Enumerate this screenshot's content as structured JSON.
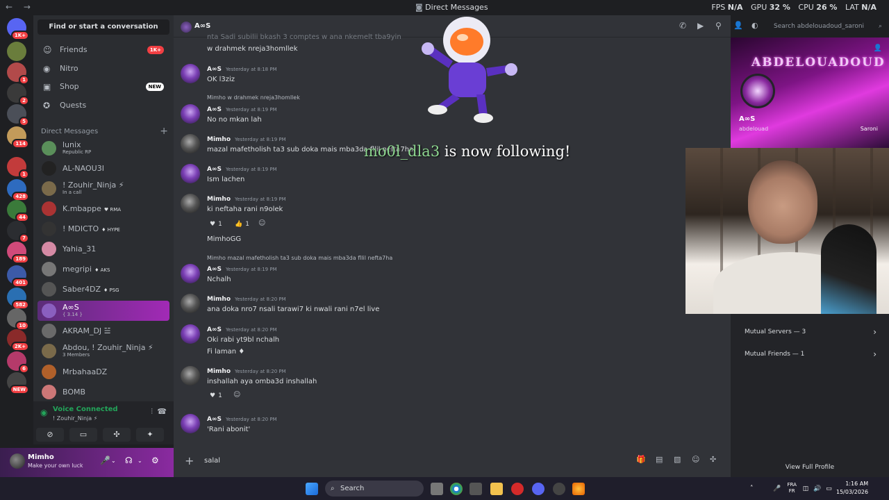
{
  "window": {
    "title": "Direct Messages",
    "nav_icons": "← →",
    "perf": [
      {
        "label": "FPS",
        "value": "N/A"
      },
      {
        "label": "GPU",
        "value": "32 %"
      },
      {
        "label": "CPU",
        "value": "26 %"
      },
      {
        "label": "LAT",
        "value": "N/A"
      }
    ]
  },
  "servers": [
    {
      "badge": "1K+",
      "color": "#5865f2"
    },
    {
      "badge": "",
      "color": "#6a7d3c"
    },
    {
      "badge": "1",
      "color": "#b24a4a"
    },
    {
      "badge": "2",
      "color": "#3a3a3a"
    },
    {
      "badge": "5",
      "color": "#4b4f58"
    },
    {
      "badge": "114",
      "color": "#c29b5a"
    },
    {
      "badge": "1",
      "color": "#c23b3b"
    },
    {
      "badge": "428",
      "color": "#2e6bbf"
    },
    {
      "badge": "44",
      "color": "#3a7a3a"
    },
    {
      "badge": "7",
      "color": "#2b2d31"
    },
    {
      "badge": "189",
      "color": "#d04a7a"
    },
    {
      "badge": "401",
      "color": "#3c5aa8"
    },
    {
      "badge": "582",
      "color": "#2a6fb2"
    },
    {
      "badge": "10",
      "color": "#666"
    },
    {
      "badge": "2K+",
      "color": "#8a2a2a"
    },
    {
      "badge": "6",
      "color": "#b53a6a"
    },
    {
      "badge": "NEW",
      "color": "#444"
    }
  ],
  "sidebar": {
    "find_label": "Find or start a conversation",
    "nav": [
      {
        "label": "Friends",
        "icon": "friends-icon",
        "glyph": "☺",
        "pill": "1K+"
      },
      {
        "label": "Nitro",
        "icon": "nitro-icon",
        "glyph": "◉",
        "pill": ""
      },
      {
        "label": "Shop",
        "icon": "shop-icon",
        "glyph": "▣",
        "pill": "NEW"
      },
      {
        "label": "Quests",
        "icon": "quests-icon",
        "glyph": "✪",
        "pill": ""
      }
    ],
    "dm_header": "Direct Messages",
    "dms": [
      {
        "name": "lunix",
        "sub": "Republic RP",
        "tag": "",
        "color": "#5a8f5a"
      },
      {
        "name": "AL-NAOU3I",
        "sub": "",
        "tag": "",
        "color": "#222"
      },
      {
        "name": "! Zouhir_Ninja ⚡",
        "sub": "In a call",
        "tag": "",
        "color": "#7a6a4a"
      },
      {
        "name": "K.mbappe",
        "sub": "",
        "tag": "♥ RMA",
        "color": "#a33"
      },
      {
        "name": "! MDICTO",
        "sub": "",
        "tag": "♦ HYPE",
        "color": "#333"
      },
      {
        "name": "Yahia_31",
        "sub": "",
        "tag": "",
        "color": "#d58aa5"
      },
      {
        "name": "megripi",
        "sub": "",
        "tag": "♦ AKS",
        "color": "#777"
      },
      {
        "name": "Saber4DZ",
        "sub": "",
        "tag": "♦ PSG",
        "color": "#555"
      },
      {
        "name": "A∞S",
        "sub": "{ 3.14 }",
        "tag": "",
        "color": "#8a5fbf"
      },
      {
        "name": "AKRAM_DJ ☱",
        "sub": "",
        "tag": "",
        "color": "#6a6a6a"
      },
      {
        "name": "Abdou, ! Zouhir_Ninja ⚡",
        "sub": "3 Members",
        "tag": "",
        "color": "#7a6a4a"
      },
      {
        "name": "MrbahaaDZ",
        "sub": "",
        "tag": "",
        "color": "#b0602a"
      },
      {
        "name": "BOMB",
        "sub": "",
        "tag": "",
        "color": "#c77"
      }
    ]
  },
  "voice": {
    "status": "Voice Connected",
    "channel": "! Zouhir_Ninja ⚡"
  },
  "user": {
    "name": "Mimho",
    "status": "Make your own luck"
  },
  "chat": {
    "header_name": "A∞S",
    "search_placeholder": "Search abdelouadoud_saroni",
    "messages": [
      {
        "type": "cont",
        "text": "w drahmek nreja3homllek"
      },
      {
        "type": "msg",
        "author": "A∞S",
        "time": "Yesterday at 8:18 PM",
        "lines": [
          "OK l3ziz"
        ],
        "av": "aos"
      },
      {
        "type": "msg",
        "reply": "Mimho w drahmek nreja3homllek",
        "author": "A∞S",
        "time": "Yesterday at 8:19 PM",
        "lines": [
          "No no mkan lah"
        ],
        "av": "aos"
      },
      {
        "type": "msg",
        "author": "Mimho",
        "time": "Yesterday at 8:19 PM",
        "lines": [
          "mazal mafetholish ta3 sub doka mais mba3da fllil nefta7ha"
        ],
        "av": "mimho"
      },
      {
        "type": "msg",
        "author": "A∞S",
        "time": "Yesterday at 8:19 PM",
        "lines": [
          "Ism lachen"
        ],
        "av": "aos"
      },
      {
        "type": "msg",
        "author": "Mimho",
        "time": "Yesterday at 8:19 PM",
        "lines": [
          "ki neftaha rani n9olek"
        ],
        "av": "mimho"
      },
      {
        "type": "cont",
        "text": "MimhoGG"
      },
      {
        "type": "msg",
        "reply": "Mimho mazal mafetholish ta3 sub doka mais mba3da fllil nefta7ha",
        "author": "A∞S",
        "time": "Yesterday at 8:19 PM",
        "lines": [
          "Nchalh"
        ],
        "av": "aos"
      },
      {
        "type": "msg",
        "author": "Mimho",
        "time": "Yesterday at 8:20 PM",
        "lines": [
          "ana doka nro7 nsali tarawi7 ki nwali rani n7el live"
        ],
        "av": "mimho"
      },
      {
        "type": "msg",
        "author": "A∞S",
        "time": "Yesterday at 8:20 PM",
        "lines": [
          "Oki rabi yt9bl nchalh"
        ],
        "av": "aos"
      },
      {
        "type": "cont",
        "text": "Fi laman ♦"
      },
      {
        "type": "msg",
        "author": "Mimho",
        "time": "Yesterday at 8:20 PM",
        "lines": [
          "inshallah aya omba3d inshallah"
        ],
        "av": "mimho"
      },
      {
        "type": "msg",
        "author": "A∞S",
        "time": "Yesterday at 8:20 PM",
        "lines": [
          "'Rani abonit'"
        ],
        "av": "aos"
      }
    ],
    "reactions1": [
      {
        "emoji": "♥",
        "count": "1"
      },
      {
        "emoji": "👍",
        "count": "1"
      }
    ],
    "reactions2": [
      {
        "emoji": "♥",
        "count": "1"
      }
    ],
    "top_cut": "nta Sadi subilii bkash 3 comptes w ana nkemelt tba9yin",
    "composer_value": "salal"
  },
  "overlay": {
    "follow_name": "mo0l_dla3",
    "follow_text": "is now following!"
  },
  "profile": {
    "banner_text": "ABDELOUADOUD",
    "name": "A∞S",
    "username": "abdelouad",
    "banner_side": "Saroni",
    "mutual_servers": "Mutual Servers — 3",
    "mutual_friends": "Mutual Friends — 1",
    "view_full": "View Full Profile"
  },
  "taskbar": {
    "search": "Search",
    "tray_lang": "FRA",
    "tray_lang2": "FR",
    "time": "1:16 AM",
    "date": "15/03/2026"
  }
}
